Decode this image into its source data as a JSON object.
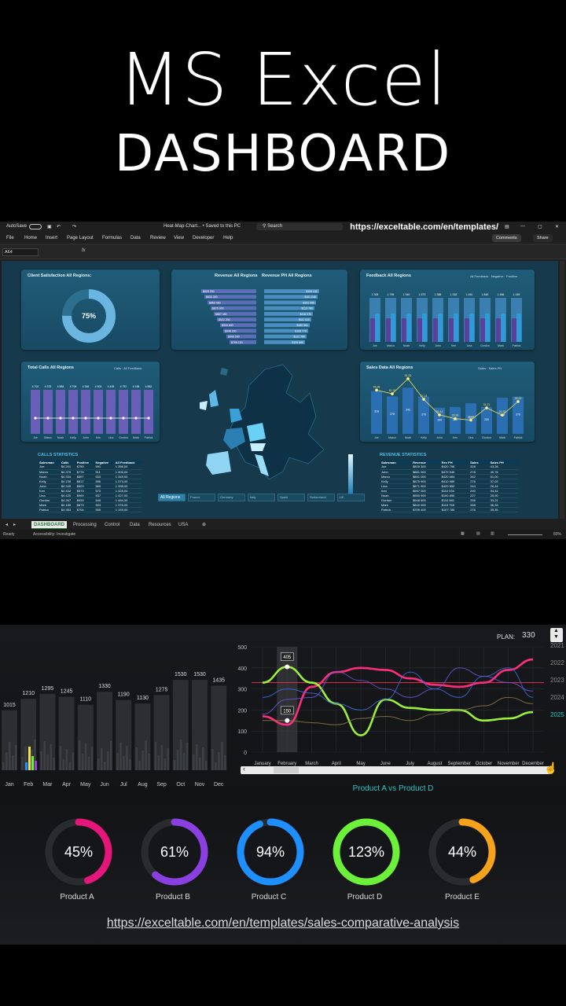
{
  "hero": {
    "title": "MS Excel",
    "subtitle": "DASHBOARD"
  },
  "excel": {
    "titlebar": {
      "autosave": "AutoSave",
      "filename": "Heat-Map-Chart... • Saved to this PC",
      "search": "Search",
      "url": "https://exceltable.com/en/templates/"
    },
    "menu": [
      "File",
      "Home",
      "Insert",
      "Page Layout",
      "Formulas",
      "Data",
      "Review",
      "View",
      "Developer",
      "Help"
    ],
    "comments": "Comments",
    "share": "Share",
    "namebox": "A64",
    "fx": "fx",
    "sheet_tabs": [
      "DASHBOARD",
      "Processing",
      "Control",
      "Data",
      "Resources",
      "USA"
    ],
    "status": {
      "ready": "Ready",
      "accessibility": "Accessibility: Investigate",
      "zoom": "80%"
    },
    "cards": {
      "client": {
        "title": "Client Satisfaction All Regions:",
        "value": "75%",
        "fraction": 0.75
      },
      "revenue": {
        "title_left": "Revenue All Regions",
        "title_right": "Revenue PH All Regions",
        "left": [
          "$809 300",
          "$830 300",
          "$865 460",
          "$875 900",
          "$887 450",
          "$922 200",
          "$930 600",
          "$948 200",
          "$946 500",
          "$799 100"
        ],
        "right": [
          "$199 410",
          "$161 049",
          "$191 996",
          "$113 780",
          "$118 976",
          "$111 410",
          "$150 961",
          "$195 770",
          "$122 780",
          "$105 980"
        ]
      },
      "feedback": {
        "title": "Feedback All Regions",
        "legend": [
          "All Feedback",
          "Negative",
          "Positive"
        ],
        "names": [
          "Joe",
          "Marco",
          "Noah",
          "Kelly",
          "John",
          "Ken",
          "Lina",
          "Gordon",
          "Mark",
          "Patrick"
        ],
        "values": [
          "1 305",
          "1 795",
          "1 340",
          "1 573",
          "1 388",
          "1 318",
          "1 451",
          "1 845",
          "1 456",
          "1 159"
        ]
      },
      "calls": {
        "title": "Total Calls All Regions",
        "legend": [
          "Calls",
          "All Feedback"
        ],
        "names": [
          "Joe",
          "Marco",
          "Noah",
          "Kelly",
          "John",
          "Ken",
          "Lina",
          "Gordon",
          "Mark",
          "Patrick"
        ],
        "values": [
          "4 701",
          "4 375",
          "4 584",
          "4 709",
          "4 346",
          "4 903",
          "4 405",
          "4 757",
          "4 198",
          "4 862"
        ]
      },
      "sales": {
        "title": "Sales Data All Regions",
        "legend": [
          "Sales",
          "Sales PH"
        ],
        "names": [
          "Joe",
          "Marco",
          "Noah",
          "Kelly",
          "John",
          "Ken",
          "Lina",
          "Gordon",
          "Mark",
          "Patrick"
        ],
        "line": [
          "43,28",
          "40,76",
          "51,00",
          "37,03",
          "26,44",
          "23,90",
          "22,94",
          "31,21",
          "26,33",
          "35,53"
        ],
        "bars": [
          "318",
          "278",
          "342",
          "276",
          "194",
          "200",
          "227",
          "200",
          "268",
          "276"
        ]
      }
    },
    "calls_stats": {
      "title": "CALLS STATISTICS",
      "headers": [
        "Salesman",
        "Calls",
        "Positive",
        "Negative",
        "All Feedback"
      ],
      "rows": [
        [
          "Joe",
          "$4 201",
          "$750",
          "591",
          "1 356,00"
        ],
        [
          "Marco",
          "$4 375",
          "$775",
          "511",
          "1 306,00"
        ],
        [
          "Noah",
          "$4 334",
          "$897",
          "533",
          "1 349,00"
        ],
        [
          "Kelly",
          "$4 236",
          "$817",
          "556",
          "1 373,00"
        ],
        [
          "John",
          "$4 345",
          "$829",
          "569",
          "1 398,00"
        ],
        [
          "Ken",
          "$4 402",
          "$973",
          "573",
          "1 328,00"
        ],
        [
          "Lina",
          "$4 420",
          "$999",
          "537",
          "1 427,00"
        ],
        [
          "Gordon",
          "$4 267",
          "$939",
          "545",
          "1 484,00"
        ],
        [
          "Mark",
          "$4 185",
          "$873",
          "503",
          "1 376,00"
        ],
        [
          "Patrick",
          "$4 383",
          "$704",
          "555",
          "1 159,00"
        ]
      ]
    },
    "revenue_stats": {
      "title": "REVENUE STATISTICS",
      "headers": [
        "Salesman",
        "Revenue",
        "Rev PH",
        "Sales",
        "Sales PH"
      ],
      "rows": [
        [
          "Joe",
          "$805 300",
          "$420 756",
          "328",
          "43,28"
        ],
        [
          "John",
          "$881 000",
          "$470 545",
          "278",
          "40,76"
        ],
        [
          "Marco",
          "$891 000",
          "$420 684",
          "342",
          "51,00"
        ],
        [
          "Kelly",
          "$875 900",
          "$410 989",
          "276",
          "37,03"
        ],
        [
          "Lina",
          "$871 900",
          "$420 852",
          "244",
          "26,44"
        ],
        [
          "Ken",
          "$957 000",
          "$110 930",
          "290",
          "34,44"
        ],
        [
          "Noah",
          "$950 900",
          "$100 850",
          "227",
          "25,90"
        ],
        [
          "Gordon",
          "$948 600",
          "$110 981",
          "256",
          "33,21"
        ],
        [
          "Mark",
          "$840 000",
          "$115 765",
          "268",
          "36,33"
        ],
        [
          "Patrick",
          "$799 400",
          "$107 780",
          "276",
          "35,35"
        ]
      ]
    },
    "region_tabs": [
      "All Regions",
      "France",
      "Germany",
      "Italy",
      "Spain",
      "Switzerland",
      "UK"
    ]
  },
  "bottom": {
    "plan_label": "PLAN:",
    "plan_value": "330",
    "comparison_label": "Product A  vs  Product D",
    "url": "https://exceltable.com/en/templates/sales-comparative-analysis",
    "years": [
      "2021",
      "2022",
      "2023",
      "2024",
      "2025"
    ],
    "rings": [
      {
        "label": "Product A",
        "value": "45%",
        "fraction": 0.45,
        "color": "#e5167a"
      },
      {
        "label": "Product B",
        "value": "61%",
        "fraction": 0.61,
        "color": "#8a3fe0"
      },
      {
        "label": "Product C",
        "value": "94%",
        "fraction": 0.94,
        "color": "#1e8fff"
      },
      {
        "label": "Product D",
        "value": "123%",
        "fraction": 1.0,
        "color": "#6cf03a"
      },
      {
        "label": "Product E",
        "value": "44%",
        "fraction": 0.44,
        "color": "#f7a21b"
      }
    ]
  },
  "chart_data": [
    {
      "type": "bar",
      "categories": [
        "Jan",
        "Feb",
        "Mar",
        "Apr",
        "May",
        "Jun",
        "Jul",
        "Aug",
        "Sep",
        "Oct",
        "Nov",
        "Dec"
      ],
      "values": [
        1015,
        1210,
        1295,
        1245,
        1110,
        1330,
        1190,
        1130,
        1275,
        1530,
        1530,
        1435
      ],
      "ylim": [
        0,
        1600
      ]
    },
    {
      "type": "line",
      "categories": [
        "January",
        "February",
        "March",
        "April",
        "May",
        "June",
        "July",
        "August",
        "September",
        "October",
        "November",
        "December"
      ],
      "ylim": [
        0,
        500
      ],
      "yticks": [
        0,
        100,
        200,
        300,
        400,
        500
      ],
      "plan": 330,
      "annotations": [
        {
          "x": "February",
          "value": 405
        },
        {
          "x": "February",
          "value": 150
        }
      ],
      "series": [
        {
          "color": "#ff2d7a",
          "values": [
            170,
            130,
            310,
            380,
            400,
            390,
            350,
            320,
            310,
            330,
            390,
            440
          ]
        },
        {
          "color": "#9cf03a",
          "values": [
            330,
            405,
            330,
            230,
            80,
            250,
            210,
            200,
            200,
            150,
            160,
            190
          ]
        },
        {
          "color": "#6a5bd9",
          "values": [
            180,
            250,
            260,
            380,
            340,
            300,
            260,
            300,
            400,
            360,
            330,
            290
          ]
        },
        {
          "color": "#3a6ee0",
          "values": [
            260,
            300,
            280,
            230,
            200,
            250,
            380,
            300,
            260,
            360,
            400,
            260
          ]
        },
        {
          "color": "#8a7a4a",
          "values": [
            150,
            150,
            140,
            130,
            160,
            170,
            150,
            180,
            200,
            220,
            260,
            230
          ]
        }
      ]
    }
  ]
}
